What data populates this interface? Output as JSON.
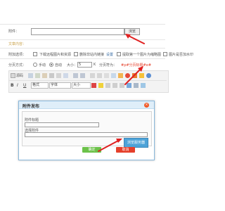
{
  "form": {
    "attachment_label": "附件：",
    "browse_button": "浏览",
    "content_label": "文章内容：",
    "extra_label": "附加选项：",
    "options": [
      "下载远程图片和资源",
      "删除非站内链接",
      "设置",
      "提取第一个图片为缩略图",
      "图片是否加水印"
    ],
    "paging_label": "分页方式：",
    "paging_manual": "手动",
    "paging_auto": "自动",
    "size_label": "大小：",
    "size_value": "5",
    "size_suffix": "K",
    "paging_title_label": "分页符为：",
    "paging_marker": "#p#分页标题#e#"
  },
  "editor": {
    "toolbar_row1": [
      "源码",
      "字号"
    ],
    "toolbar_row3": [
      "格式",
      "字体",
      "大小"
    ]
  },
  "dialog": {
    "title": "附件发布",
    "title_field_label": "附件标题",
    "address_label": "选择附件",
    "browse_server_button": "浏览服务器",
    "ok_button": "确定",
    "cancel_button": "取消"
  },
  "colors": {
    "accent_orange": "#f05a28",
    "confirm_green": "#6cc24a",
    "cancel_red": "#e5402b",
    "arrow_red": "#e02020",
    "dialog_blue": "#4da3d8",
    "section_yellow": "#c9a24a"
  },
  "icons": [
    "source-icon",
    "bold-icon",
    "italic-icon",
    "underline-icon",
    "link-icon",
    "image-icon",
    "flash-icon",
    "table-icon",
    "smiley-icon",
    "special-char-icon",
    "attachment-icon",
    "close-icon"
  ]
}
